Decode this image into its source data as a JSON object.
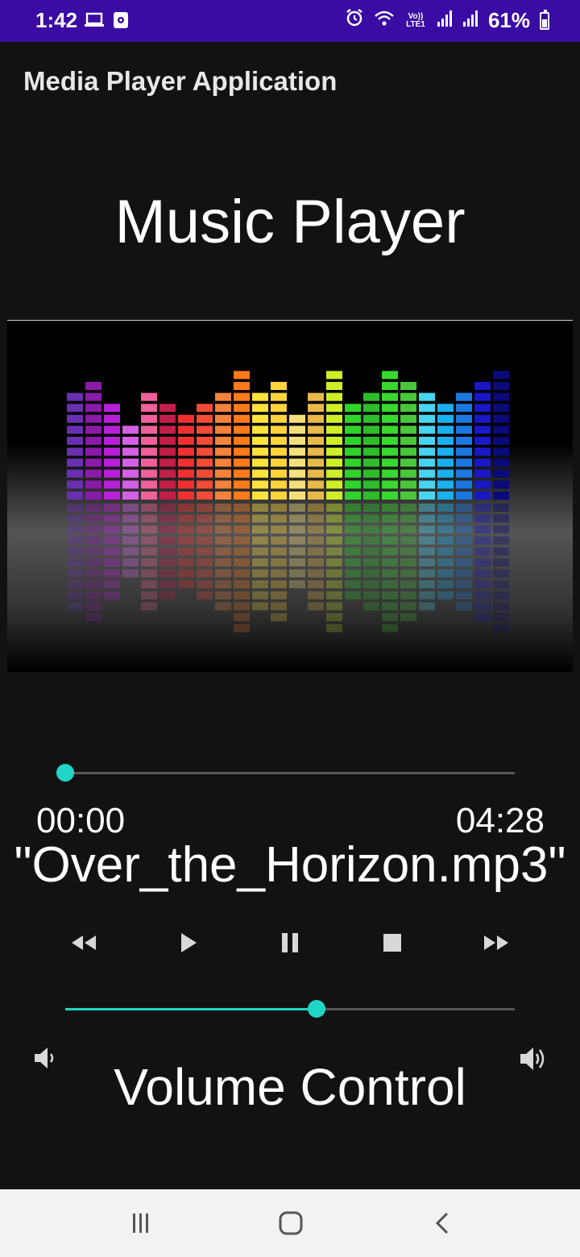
{
  "status_bar": {
    "time": "1:42",
    "battery": "61%",
    "network_label": "Vo)) LTE1"
  },
  "app_bar": {
    "title": "Media Player Application"
  },
  "screen_title": "Music Player",
  "player": {
    "elapsed": "00:00",
    "duration": "04:28",
    "track_name": "\"Over_the_Horizon.mp3\"",
    "progress": 0.0,
    "accent_color": "#1fd6c6"
  },
  "controls": [
    {
      "name": "rewind-button",
      "icon": "rewind-icon"
    },
    {
      "name": "play-button",
      "icon": "play-icon"
    },
    {
      "name": "pause-button",
      "icon": "pause-icon"
    },
    {
      "name": "stop-button",
      "icon": "stop-icon"
    },
    {
      "name": "fast-forward-button",
      "icon": "fast-forward-icon"
    }
  ],
  "volume": {
    "label": "Volume Control",
    "level": 0.56
  },
  "equalizer_art": {
    "bar_levels": [
      10,
      11,
      9,
      7,
      10,
      9,
      8,
      9,
      10,
      12,
      10,
      11,
      8,
      10,
      12,
      9,
      10,
      12,
      11,
      10,
      9,
      10,
      11,
      12
    ],
    "bar_colors": [
      "#6a2fb0",
      "#8a1aa8",
      "#b81fd8",
      "#d560e6",
      "#f0609a",
      "#c21e4a",
      "#f03030",
      "#f44a36",
      "#f5823a",
      "#ff7a1a",
      "#ffe23c",
      "#ffd43a",
      "#f3e07a",
      "#e8b848",
      "#cfee26",
      "#2fd42a",
      "#2dbd2a",
      "#38d82e",
      "#48c838",
      "#46d4f0",
      "#1ab0f0",
      "#1a78e0",
      "#1818c8",
      "#0a0a7a"
    ]
  }
}
